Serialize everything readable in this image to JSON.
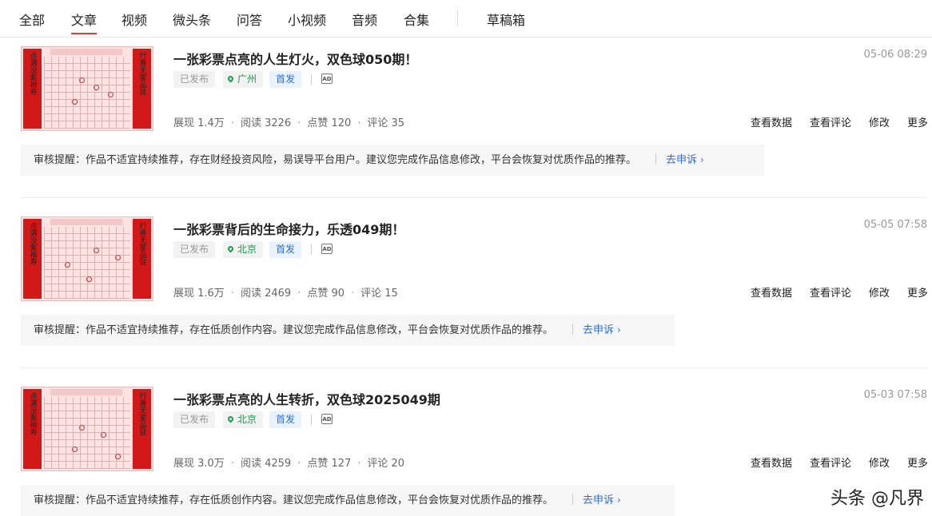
{
  "tabs": [
    {
      "label": "全部"
    },
    {
      "label": "文章"
    },
    {
      "label": "视频"
    },
    {
      "label": "微头条"
    },
    {
      "label": "问答"
    },
    {
      "label": "小视频"
    },
    {
      "label": "音频"
    },
    {
      "label": "合集"
    }
  ],
  "active_tab": "文章",
  "drafts_label": "草稿箱",
  "articles": [
    {
      "title": "一张彩票点亮的人生灯火，双色球050期！",
      "date": "05-06 08:29",
      "status": "已发布",
      "location": "广州",
      "first_badge": "首发",
      "ad_icon": "AD",
      "impressions": "展现 1.4万",
      "reads": "阅读 3226",
      "likes": "点赞 120",
      "comments": "评论 35",
      "notice": "审核提醒：作品不适宜持续推荐，存在财经投资风险，易误导平台用户。建议您完成作品信息修改，平台会恢复对优质作品的推荐。",
      "appeal": "去申诉"
    },
    {
      "title": "一张彩票背后的生命接力，乐透049期！",
      "date": "05-05 07:58",
      "status": "已发布",
      "location": "北京",
      "first_badge": "首发",
      "ad_icon": "AD",
      "impressions": "展现 1.6万",
      "reads": "阅读 2469",
      "likes": "点赞 90",
      "comments": "评论 15",
      "notice": "审核提醒：作品不适宜持续推荐，存在低质创作内容。建议您完成作品信息修改，平台会恢复对优质作品的推荐。",
      "appeal": "去申诉"
    },
    {
      "title": "一张彩票点亮的人生转折，双色球2025049期",
      "date": "05-03 07:58",
      "status": "已发布",
      "location": "北京",
      "first_badge": "首发",
      "ad_icon": "AD",
      "impressions": "展现 3.0万",
      "reads": "阅读 4259",
      "likes": "点赞 127",
      "comments": "评论 20",
      "notice": "审核提醒：作品不适宜持续推荐，存在低质创作内容。建议您完成作品信息修改，平台会恢复对优质作品的推荐。",
      "appeal": "去申诉"
    }
  ],
  "actions": {
    "view_data": "查看数据",
    "view_comments": "查看评论",
    "edit": "修改",
    "more": "更多"
  },
  "thumb_text": {
    "left": "点满没紫福寿",
    "right": "行喜无家品驻"
  },
  "watermark": "头条 @凡界",
  "colors": {
    "accent_red": "#e03a3a",
    "location_green": "#15a04b",
    "link_blue": "#2f6fd8"
  }
}
